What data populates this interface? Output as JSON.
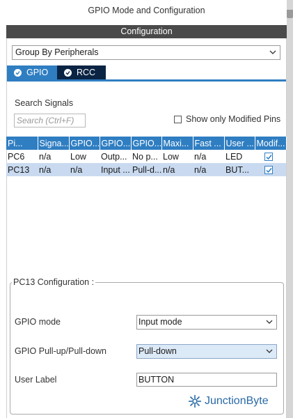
{
  "window": {
    "title": "GPIO Mode and Configuration"
  },
  "config": {
    "header": "Configuration",
    "group_by": "Group By Peripherals",
    "tabs": [
      {
        "label": "GPIO"
      },
      {
        "label": "RCC"
      }
    ]
  },
  "search": {
    "label": "Search Signals",
    "placeholder": "Search (Ctrl+F)",
    "show_modified_label": "Show only Modified Pins"
  },
  "table": {
    "headers": [
      "Pi...",
      "Signa...",
      "GPIO...",
      "GPIO...",
      "GPIO...",
      "Maxi...",
      "Fast ...",
      "User ...",
      "Modif..."
    ],
    "rows": [
      [
        "PC6",
        "n/a",
        "Low",
        "Outp...",
        "No p...",
        "Low",
        "n/a",
        "LED"
      ],
      [
        "PC13",
        "n/a",
        "n/a",
        "Input ...",
        "Pull-d...",
        "n/a",
        "n/a",
        "BUT..."
      ]
    ]
  },
  "pc13": {
    "legend": "PC13 Configuration :",
    "gpio_mode_label": "GPIO mode",
    "gpio_mode_value": "Input mode",
    "pull_label": "GPIO Pull-up/Pull-down",
    "pull_value": "Pull-down",
    "user_label_label": "User Label",
    "user_label_value": "BUTTON"
  },
  "brand": {
    "name": "JunctionByte"
  },
  "colors": {
    "accent": "#2f7ec2",
    "tab_dark": "#0b2444",
    "header_bar": "#4a4a4a",
    "selected_row": "#c9daf0"
  }
}
